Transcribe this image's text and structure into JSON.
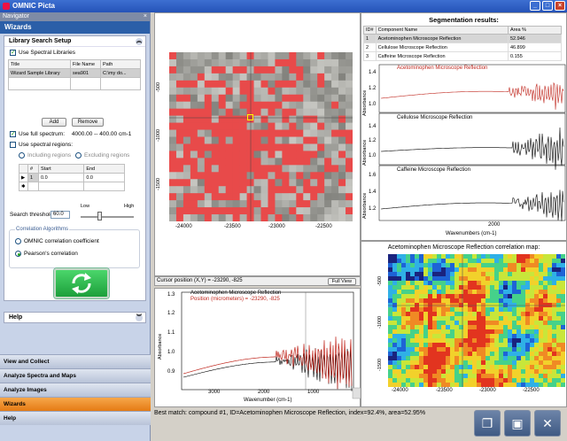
{
  "window": {
    "title": "OMNIC Picta"
  },
  "navigator": {
    "label": "Navigator",
    "panel_title": "Wizards"
  },
  "library_setup": {
    "title": "Library Search Setup",
    "use_spectral_libraries": "Use Spectral Libraries",
    "columns": [
      "Title",
      "File Name",
      "Path"
    ],
    "rows": [
      [
        "Wizard Sample Library",
        "sea901",
        "C:\\my do..."
      ]
    ],
    "add": "Add",
    "remove": "Remove",
    "use_full_spectrum": "Use full spectrum:",
    "full_range": "4000.00 -- 400.00 cm-1",
    "use_spectral_regions": "Use spectral regions:",
    "including": "Including regions",
    "excluding": "Excluding regions",
    "region_cols": [
      "#",
      "Start",
      "End"
    ],
    "region_rows": [
      [
        "1",
        "0.0",
        "0.0"
      ]
    ],
    "search_threshold_label": "Search threshold:",
    "search_threshold_value": "60.0",
    "slider_low": "Low",
    "slider_high": "High",
    "slider_level": 0.35,
    "correlation_title": "Correlation Algorithms",
    "omnic_corr": "OMNIC correlation coefficient",
    "pearson": "Pearson's correlation"
  },
  "help_panel": {
    "title": "Help"
  },
  "nav_buttons": [
    "View and Collect",
    "Analyze Spectra and Maps",
    "Analyze Images",
    "Wizards",
    "Help"
  ],
  "image_view": {
    "x_ticks": [
      "-24000",
      "-23500",
      "-23000",
      "-22500"
    ],
    "y_ticks": [
      "-500",
      "-1000",
      "-1500"
    ],
    "cursor_text": "Cursor position (X,Y) = -23290, -825",
    "full_view": "Full View"
  },
  "spectrum_view": {
    "legend1": "Acetominophen Microscope Reflection",
    "legend2": "Position (micrometers) = -23290, -825",
    "y_ticks": [
      "1.3",
      "1.2",
      "1.1",
      "1.0",
      "0.9"
    ],
    "x_ticks": [
      "3000",
      "2000",
      "1000"
    ],
    "y_label": "Absorbance",
    "x_label": "Wavenumber (cm-1)"
  },
  "segmentation": {
    "title": "Segmentation results:",
    "columns": [
      "ID#",
      "Component Name",
      "Area %"
    ],
    "rows": [
      [
        "1",
        "Acetominophen Microscope Reflection",
        "52.946"
      ],
      [
        "2",
        "Cellulose Microscope Reflection",
        "46.899"
      ],
      [
        "3",
        "Caffeine Microscope Reflection",
        "0.155"
      ]
    ],
    "plot1_label": "Acetominophen Microscope Reflection",
    "plot2_label": "Cellulose Microscope Reflection",
    "plot3_label": "Caffeine Microscope Reflection",
    "plot1_ticks": [
      "1.4",
      "1.2",
      "1.0"
    ],
    "plot2_ticks": [
      "1.4",
      "1.2",
      "1.0"
    ],
    "plot3_ticks": [
      "1.6",
      "1.4",
      "1.2"
    ],
    "y_label": "Absorbance",
    "x_ticks": [
      "2000"
    ],
    "x_label": "Wavenumbers (cm-1)"
  },
  "correlation_map": {
    "title": "Acetominophen Microscope Reflection correlation map:",
    "x_ticks": [
      "-24000",
      "-23500",
      "-23000",
      "-22500"
    ],
    "y_ticks": [
      "-500",
      "-1000",
      "-1500"
    ]
  },
  "status": {
    "best_match": "Best match: compound #1, ID=Acetominophen Microscope Reflection, index=92.4%, area=52.95%"
  }
}
